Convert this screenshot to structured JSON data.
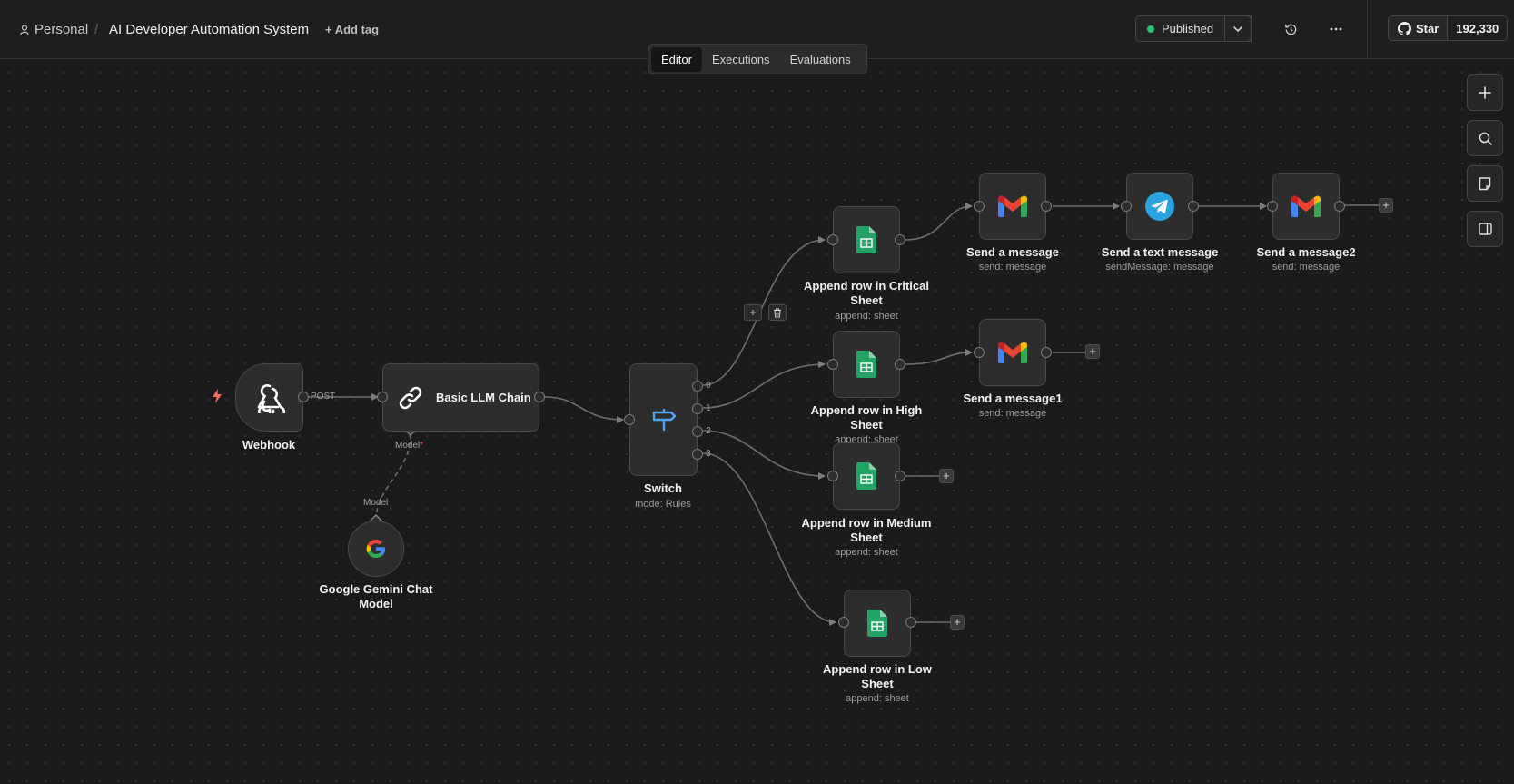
{
  "header": {
    "workspace": "Personal",
    "separator": "/",
    "workflow_title": "AI Developer Automation System",
    "add_tag": "+ Add tag",
    "publish_status": "Published",
    "github_star": "Star",
    "github_count": "192,330"
  },
  "tabs": [
    {
      "label": "Editor",
      "active": true
    },
    {
      "label": "Executions",
      "active": false
    },
    {
      "label": "Evaluations",
      "active": false
    }
  ],
  "nodes": {
    "webhook": {
      "label": "Webhook",
      "icon": "webhook-icon"
    },
    "llm_chain": {
      "label": "Basic LLM Chain",
      "icon": "link-icon",
      "port_label": "Model",
      "port_required": "*"
    },
    "gemini": {
      "label": "Google Gemini Chat Model",
      "port_label": "Model",
      "icon": "google-g-icon"
    },
    "switch": {
      "label": "Switch",
      "sub": "mode: Rules",
      "outputs": [
        "0",
        "1",
        "2",
        "3"
      ]
    },
    "sheet_critical": {
      "label": "Append row in Critical Sheet",
      "sub": "append: sheet"
    },
    "sheet_high": {
      "label": "Append row in High Sheet",
      "sub": "append: sheet"
    },
    "sheet_medium": {
      "label": "Append row in Medium Sheet",
      "sub": "append: sheet"
    },
    "sheet_low": {
      "label": "Append row in Low Sheet",
      "sub": "append: sheet"
    },
    "gmail_1": {
      "label": "Send a message",
      "sub": "send: message"
    },
    "telegram": {
      "label": "Send a text message",
      "sub": "sendMessage: message"
    },
    "gmail_2": {
      "label": "Send a message2",
      "sub": "send: message"
    },
    "gmail_high": {
      "label": "Send a message1",
      "sub": "send: message"
    }
  },
  "edge_labels": {
    "webhook_method": "POST"
  },
  "colors": {
    "accent_green": "#2ec36b",
    "trigger": "#ff6d5a",
    "sheets": "#21a464",
    "telegram": "#2aa3e0",
    "switch": "#4ea5f2"
  }
}
